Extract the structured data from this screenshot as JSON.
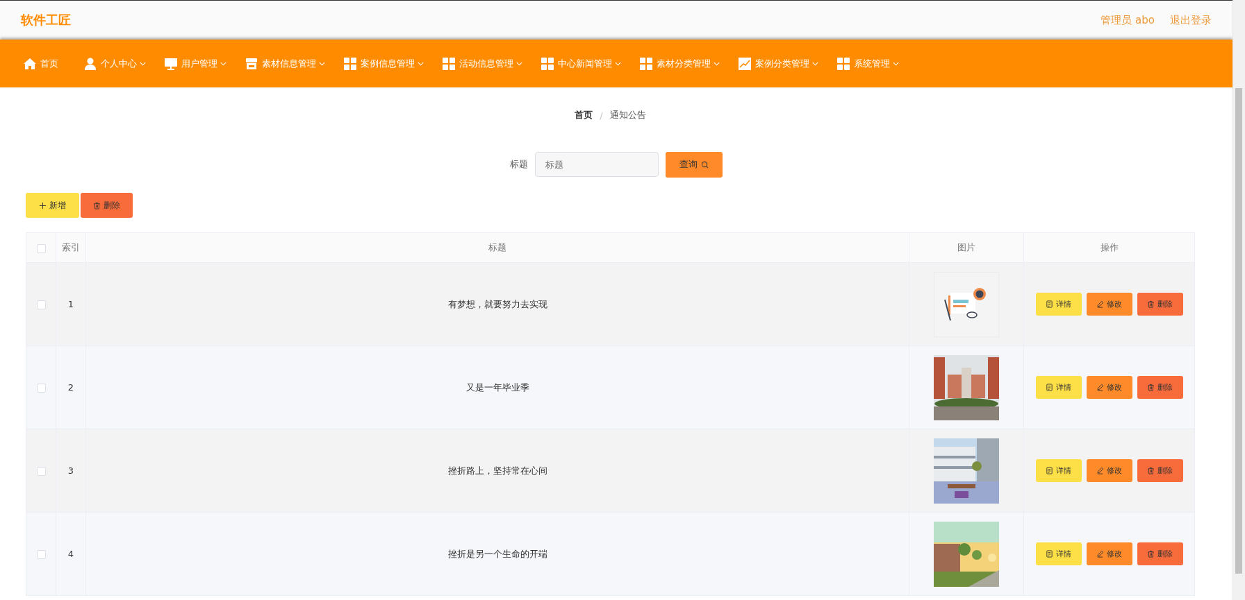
{
  "header": {
    "brand": "软件工匠",
    "user": "管理员 abo",
    "logout": "退出登录"
  },
  "nav": [
    {
      "label": "首页",
      "dropdown": false
    },
    {
      "label": "个人中心",
      "dropdown": true
    },
    {
      "label": "用户管理",
      "dropdown": true
    },
    {
      "label": "素材信息管理",
      "dropdown": true
    },
    {
      "label": "案例信息管理",
      "dropdown": true
    },
    {
      "label": "活动信息管理",
      "dropdown": true
    },
    {
      "label": "中心新闻管理",
      "dropdown": true
    },
    {
      "label": "素材分类管理",
      "dropdown": true
    },
    {
      "label": "案例分类管理",
      "dropdown": true
    },
    {
      "label": "系统管理",
      "dropdown": true
    }
  ],
  "breadcrumb": {
    "items": [
      "首页",
      "通知公告"
    ],
    "separator": "/"
  },
  "search": {
    "label": "标题",
    "placeholder": "标题",
    "button": "查询"
  },
  "toolbar": {
    "add": "新增",
    "delete": "删除"
  },
  "table": {
    "columns": [
      "索引",
      "标题",
      "图片",
      "操作"
    ],
    "select_all": {
      "checked": false
    },
    "rows": [
      {
        "checked": false,
        "index": "1",
        "title": "有梦想，就要努力去实现",
        "image": {
          "kind": "picture"
        },
        "actions": [
          "详情",
          "修改",
          "删除"
        ]
      },
      {
        "checked": false,
        "index": "2",
        "title": "又是一年毕业季",
        "image": {
          "kind": "picture"
        },
        "actions": [
          "详情",
          "修改",
          "删除"
        ]
      },
      {
        "checked": false,
        "index": "3",
        "title": "挫折路上，坚持常在心间",
        "image": {
          "kind": "picture"
        },
        "actions": [
          "详情",
          "修改",
          "删除"
        ]
      },
      {
        "checked": false,
        "index": "4",
        "title": "挫折是另一个生命的开端",
        "image": {
          "kind": "picture"
        },
        "actions": [
          "详情",
          "修改",
          "删除"
        ]
      }
    ]
  }
}
